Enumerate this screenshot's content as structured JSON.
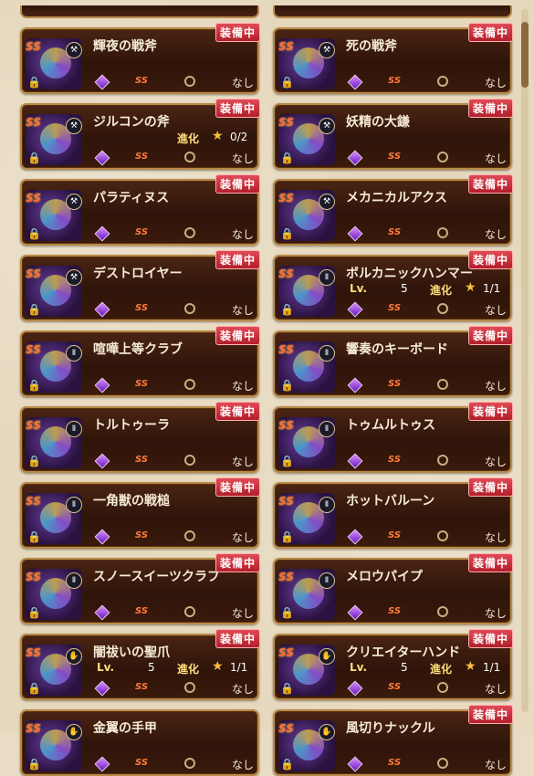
{
  "badge_label": "装備中",
  "none_label": "なし",
  "lv_label": "Lv.",
  "evo_label": "進化",
  "rarity_label": "S",
  "top_fragments": [
    {
      "name": ""
    },
    {
      "name": ""
    }
  ],
  "cards": [
    {
      "name": "輝夜の戦斧",
      "type": "axe",
      "equipped": true,
      "lv": "",
      "evo": "",
      "slots": "gem-ss-ring-none"
    },
    {
      "name": "死の戦斧",
      "type": "axe",
      "equipped": true,
      "lv": "",
      "evo": ""
    },
    {
      "name": "ジルコンの斧",
      "type": "axe",
      "equipped": true,
      "lv": "",
      "evo": "0/2",
      "slots": "gem-ssss"
    },
    {
      "name": "妖精の大鎌",
      "type": "axe",
      "equipped": true,
      "lv": "",
      "evo": ""
    },
    {
      "name": "パラティヌス",
      "type": "axe",
      "equipped": true,
      "lv": "",
      "evo": ""
    },
    {
      "name": "メカニカルアクス",
      "type": "axe",
      "equipped": true,
      "lv": "",
      "evo": ""
    },
    {
      "name": "デストロイヤー",
      "type": "axe",
      "equipped": true,
      "lv": "",
      "evo": ""
    },
    {
      "name": "ボルカニックハンマー",
      "type": "hammer",
      "equipped": true,
      "lv": "5",
      "evo": "1/1"
    },
    {
      "name": "喧嘩上等クラブ",
      "type": "hammer",
      "equipped": true,
      "lv": "",
      "evo": ""
    },
    {
      "name": "響奏のキーボード",
      "type": "hammer",
      "equipped": true,
      "lv": "",
      "evo": ""
    },
    {
      "name": "トルトゥーラ",
      "type": "hammer",
      "equipped": true,
      "lv": "",
      "evo": ""
    },
    {
      "name": "トゥムルトゥス",
      "type": "hammer",
      "equipped": true,
      "lv": "",
      "evo": ""
    },
    {
      "name": "一角獣の戦槌",
      "type": "hammer",
      "equipped": true,
      "lv": "",
      "evo": ""
    },
    {
      "name": "ホットバルーン",
      "type": "hammer",
      "equipped": true,
      "lv": "",
      "evo": ""
    },
    {
      "name": "スノースイーツクラブ",
      "type": "hammer",
      "equipped": true,
      "lv": "",
      "evo": ""
    },
    {
      "name": "メロウパイプ",
      "type": "hammer",
      "equipped": true,
      "lv": "",
      "evo": ""
    },
    {
      "name": "闇祓いの聖爪",
      "type": "claw",
      "equipped": true,
      "lv": "5",
      "evo": "1/1"
    },
    {
      "name": "クリエイターハンド",
      "type": "claw",
      "equipped": true,
      "lv": "5",
      "evo": "1/1"
    },
    {
      "name": "金翼の手甲",
      "type": "claw",
      "equipped": false,
      "lv": "",
      "evo": ""
    },
    {
      "name": "風切りナックル",
      "type": "claw",
      "equipped": true,
      "lv": "",
      "evo": ""
    }
  ]
}
